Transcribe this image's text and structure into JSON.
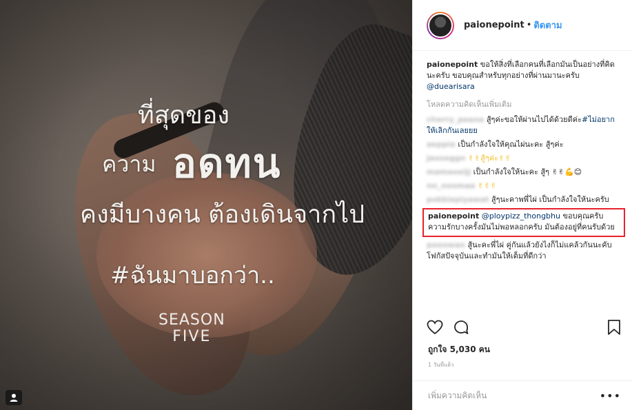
{
  "photo": {
    "overlay_line1": "ที่สุดของ",
    "overlay_line2a": "ความ",
    "overlay_line2b": "อดทน",
    "overlay_line3": "คงมีบางคน ต้องเดินจากไป",
    "overlay_line4": "#ฉันมาบอกว่า..",
    "brand_line1": "SEASON",
    "brand_line2": "FIVE"
  },
  "header": {
    "username": "paionepoint",
    "separator": "•",
    "follow_label": "ติดตาม"
  },
  "caption": {
    "username": "paionepoint",
    "text": "ขอให้สิ่งที่เลือกคนที่เลือกมันเป็นอย่างที่คิดนะครับ ขอบคุณสำหรับทุกอย่างที่ผ่านมานะครับ",
    "mention": "@duearisara"
  },
  "load_more": "โหลดความคิดเห็นเพิ่มเติม",
  "comments": [
    {
      "user": "cherry_peana",
      "text": "สู้ๆค่ะขอให้ผ่านไปได้ด้วยดีค่ะ",
      "hashtag": "#ไม่อยากให้เลิกกันเลยยย"
    },
    {
      "user": "aeppia",
      "text": "เป็นกำลังใจให้คุณไผ่นะคะ สู้ๆค่ะ"
    },
    {
      "user": "jaoseggn",
      "text": "✌✌สู้ๆค่ะ✌✌"
    },
    {
      "user": "mamaoeijj",
      "text": "เป็นกำลังใจให้นะคะ สู้ๆ ✌✌💪😊"
    },
    {
      "user": "nn_noomaa",
      "text": "✌✌✌"
    },
    {
      "user": "pokkiepiyawat",
      "text": "สู้ๆนะคาพพี่ไผ่ เป็นกำลังใจให้นะครับ"
    },
    {
      "user": "paionepoint",
      "mention": "@ploypizz_thongbhu",
      "text": "ขอบคุณครับ ความรักบางครั้งมันไม่พอหลอกครับ มันต้องอยู่ที่คนรับด้วย"
    },
    {
      "user": "pooowan",
      "text": "สู้นะคะพี่ไผ่ คู่กันแล้วยังไงก็ไม่แคล้วกันนะคับ โฟกัสปัจจุบันและทำมันให้เต็มที่ดีกว่า"
    }
  ],
  "likes_label": "ถูกใจ 5,030 คน",
  "time_label": "1 วันที่แล้ว",
  "add_comment_placeholder": "เพิ่มความคิดเห็น",
  "more_label": "•••"
}
